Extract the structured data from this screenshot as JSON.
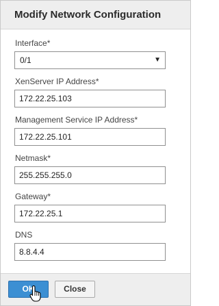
{
  "dialog": {
    "title": "Modify Network Configuration"
  },
  "form": {
    "interface": {
      "label": "Interface*",
      "value": "0/1",
      "arrow": "▼"
    },
    "xenserver_ip": {
      "label": "XenServer IP Address*",
      "value": "172.22.25.103"
    },
    "management_ip": {
      "label": "Management Service IP Address*",
      "value": "172.22.25.101"
    },
    "netmask": {
      "label": "Netmask*",
      "value": "255.255.255.0"
    },
    "gateway": {
      "label": "Gateway*",
      "value": "172.22.25.1"
    },
    "dns": {
      "label": "DNS",
      "value": "8.8.4.4"
    }
  },
  "buttons": {
    "ok_label": "OK",
    "close_label": "Close"
  },
  "colors": {
    "ok_button": "#3c8fd3",
    "header_bg": "#eeeeee"
  },
  "icons": {
    "cursor": "hand-pointer-icon"
  }
}
